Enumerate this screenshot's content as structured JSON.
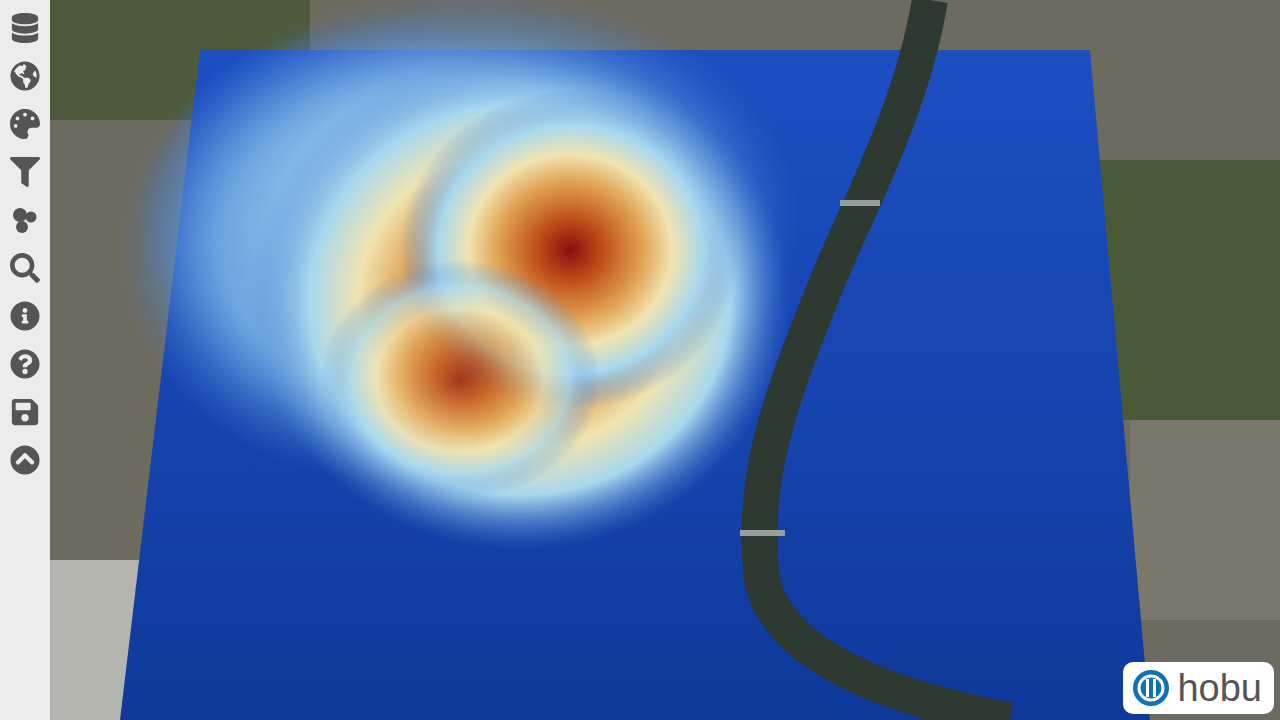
{
  "logo": {
    "text": "hobu"
  }
}
